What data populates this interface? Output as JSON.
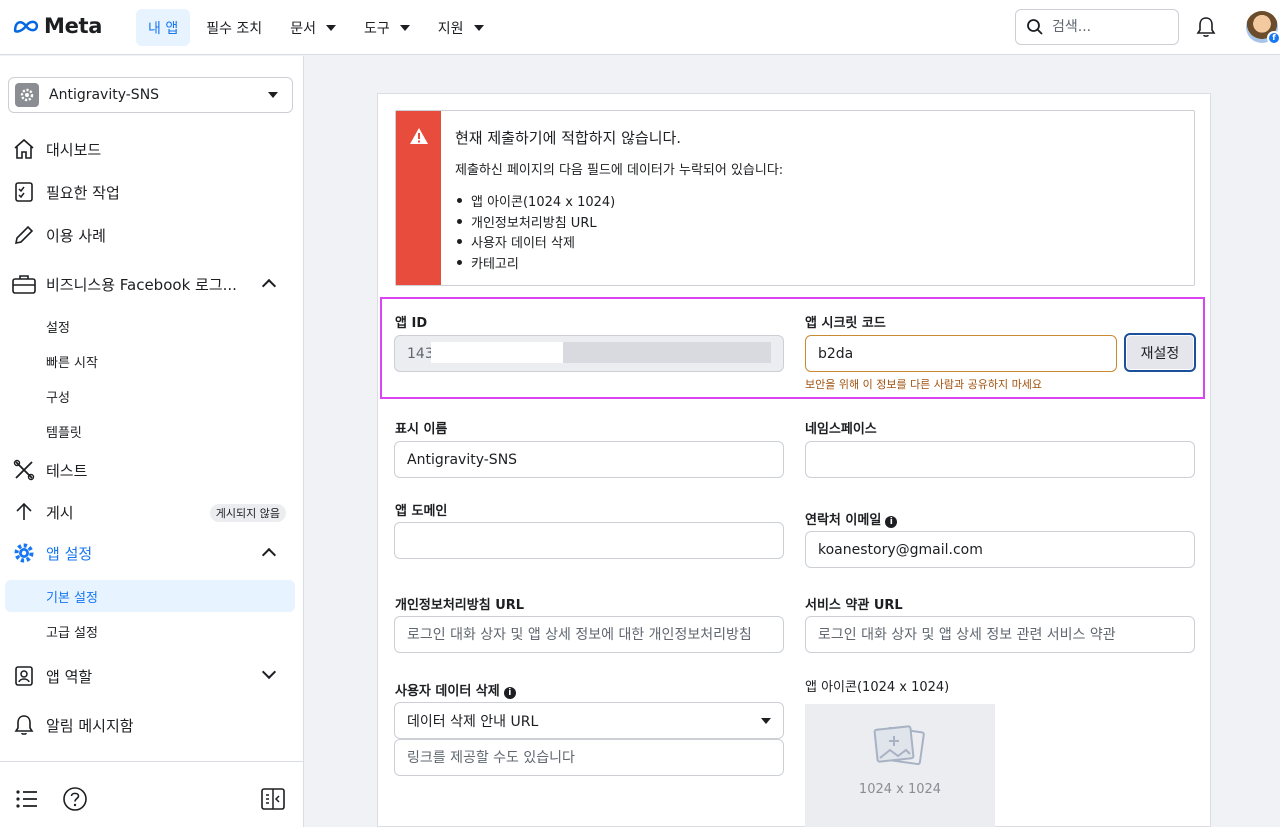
{
  "topbar": {
    "logo": "Meta",
    "nav": [
      {
        "label": "내 앱",
        "active": true,
        "dropdown": false
      },
      {
        "label": "필수 조치",
        "active": false,
        "dropdown": false
      },
      {
        "label": "문서",
        "active": false,
        "dropdown": true
      },
      {
        "label": "도구",
        "active": false,
        "dropdown": true
      },
      {
        "label": "지원",
        "active": false,
        "dropdown": true
      }
    ],
    "search_placeholder": "검색..."
  },
  "sidebar": {
    "app_name": "Antigravity-SNS",
    "items": {
      "dashboard": "대시보드",
      "required_actions": "필요한 작업",
      "use_cases": "이용 사례",
      "business_login": "비즈니스용 Facebook 로그...",
      "settings": "설정",
      "quickstart": "빠른 시작",
      "configuration": "구성",
      "templates": "템플릿",
      "test": "테스트",
      "publish": "게시",
      "publish_badge": "게시되지 않음",
      "app_settings": "앱 설정",
      "basic_settings": "기본 설정",
      "advanced_settings": "고급 설정",
      "app_roles": "앱 역할",
      "alerts": "알림 메시지함"
    }
  },
  "alert": {
    "title": "현재 제출하기에 적합하지 않습니다.",
    "description": "제출하신 페이지의 다음 필드에 데이터가 누락되어 있습니다:",
    "missing_fields": [
      "앱 아이콘(1024 x 1024)",
      "개인정보처리방침 URL",
      "사용자 데이터 삭제",
      "카테고리"
    ]
  },
  "form": {
    "app_id_label": "앱 ID",
    "app_id_value": "143",
    "app_secret_label": "앱 시크릿 코드",
    "app_secret_value": "b2da",
    "reset_button": "재설정",
    "secret_hint": "보안을 위해 이 정보를 다른 사람과 공유하지 마세요",
    "display_name_label": "표시 이름",
    "display_name_value": "Antigravity-SNS",
    "namespace_label": "네임스페이스",
    "namespace_value": "",
    "app_domain_label": "앱 도메인",
    "contact_email_label": "연락처 이메일",
    "contact_email_value": "koanestory@gmail.com",
    "privacy_url_label": "개인정보처리방침 URL",
    "privacy_url_placeholder": "로그인 대화 상자 및 앱 상세 정보에 대한 개인정보처리방침",
    "tos_url_label": "서비스 약관 URL",
    "tos_url_placeholder": "로그인 대화 상자 및 앱 상세 정보 관련 서비스 약관",
    "data_deletion_label": "사용자 데이터 삭제",
    "data_deletion_option": "데이터 삭제 안내 URL",
    "data_deletion_placeholder": "링크를 제공할 수도 있습니다",
    "app_icon_label": "앱 아이콘(1024 x 1024)",
    "app_icon_dimensions": "1024 x 1024"
  },
  "colors": {
    "brand": "#1877f2",
    "alert_red": "#e74c3c",
    "highlight": "#d946ef",
    "hint": "#a0520f"
  }
}
